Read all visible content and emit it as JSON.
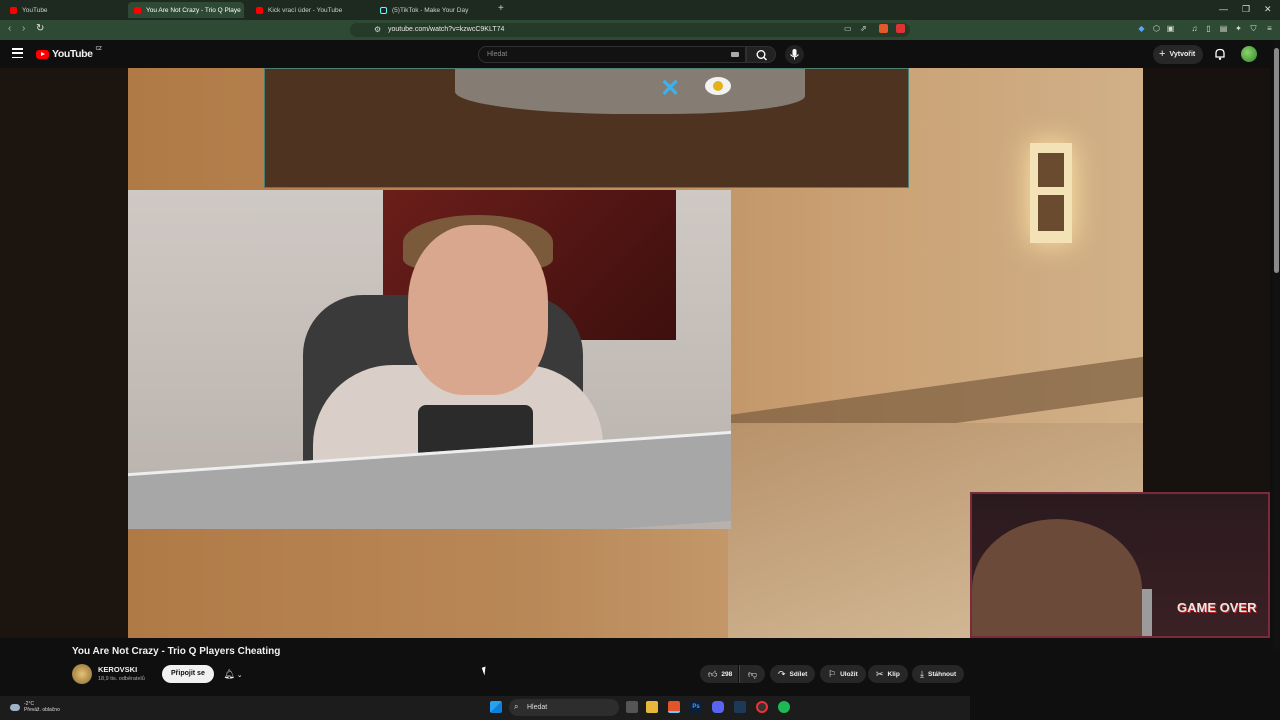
{
  "browser": {
    "tabs": [
      {
        "title": "YouTube",
        "active": false
      },
      {
        "title": "You Are Not Crazy - Trio Q Playe",
        "active": true
      },
      {
        "title": "Kick vrací úder - YouTube",
        "active": false
      },
      {
        "title": "(5)TikTok - Make Your Day",
        "active": false
      }
    ],
    "url": "youtube.com/watch?v=kzwcC9KLT74",
    "new_tab_icon": "+",
    "colors": {
      "tabstrip": "#1e2a20",
      "toolbar": "#2f4a34"
    }
  },
  "masthead": {
    "logo_text": "YouTube",
    "country_code": "CZ",
    "search_placeholder": "Hledat",
    "create_label": "Vytvořit"
  },
  "video": {
    "title": "You Are Not Crazy - Trio Q Players Cheating",
    "overlay_text": "GAME OVER"
  },
  "channel": {
    "name": "KEROVSKI",
    "subscribers": "18,9 tis. odběratelů",
    "join_label": "Připojit se"
  },
  "actions": {
    "like_count": "298",
    "share_label": "Sdílet",
    "save_label": "Uložit",
    "clip_label": "Klip",
    "download_label": "Stáhnout"
  },
  "taskbar": {
    "weather_temp": "-2°C",
    "weather_desc": "Převáž. oblačno",
    "search_label": "Hledat"
  },
  "colors": {
    "youtube_red": "#ff0000",
    "page_bg": "#0f0f0f",
    "chip_bg": "#272727"
  }
}
